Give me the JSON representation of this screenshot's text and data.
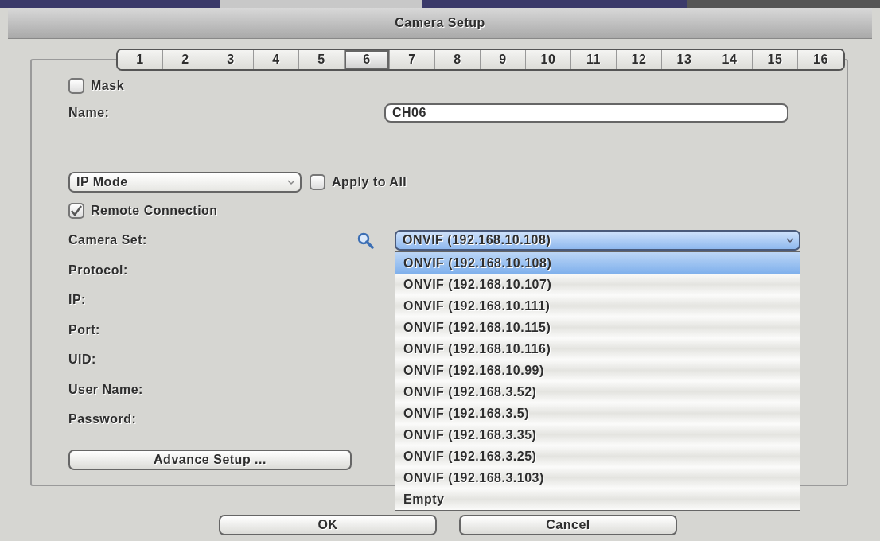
{
  "window": {
    "title": "Camera Setup"
  },
  "channel_tabs": [
    {
      "label": "1",
      "selected": false
    },
    {
      "label": "2",
      "selected": false
    },
    {
      "label": "3",
      "selected": false
    },
    {
      "label": "4",
      "selected": false
    },
    {
      "label": "5",
      "selected": false
    },
    {
      "label": "6",
      "selected": true
    },
    {
      "label": "7",
      "selected": false
    },
    {
      "label": "8",
      "selected": false
    },
    {
      "label": "9",
      "selected": false
    },
    {
      "label": "10",
      "selected": false
    },
    {
      "label": "11",
      "selected": false
    },
    {
      "label": "12",
      "selected": false
    },
    {
      "label": "13",
      "selected": false
    },
    {
      "label": "14",
      "selected": false
    },
    {
      "label": "15",
      "selected": false
    },
    {
      "label": "16",
      "selected": false
    }
  ],
  "mask": {
    "label": "Mask",
    "checked": false
  },
  "name": {
    "label": "Name:",
    "value": "CH06"
  },
  "mode_select": {
    "value": "IP Mode"
  },
  "apply_to_all": {
    "label": "Apply to All",
    "checked": false
  },
  "remote_connection": {
    "label": "Remote Connection",
    "checked": true
  },
  "camera_set": {
    "label": "Camera Set:",
    "value": "ONVIF (192.168.10.108)",
    "expanded": true,
    "options": [
      {
        "label": "ONVIF (192.168.10.108)",
        "selected": true
      },
      {
        "label": "ONVIF (192.168.10.107)",
        "selected": false
      },
      {
        "label": "ONVIF (192.168.10.111)",
        "selected": false
      },
      {
        "label": "ONVIF (192.168.10.115)",
        "selected": false
      },
      {
        "label": "ONVIF (192.168.10.116)",
        "selected": false
      },
      {
        "label": "ONVIF (192.168.10.99)",
        "selected": false
      },
      {
        "label": "ONVIF (192.168.3.52)",
        "selected": false
      },
      {
        "label": "ONVIF (192.168.3.5)",
        "selected": false
      },
      {
        "label": "ONVIF (192.168.3.35)",
        "selected": false
      },
      {
        "label": "ONVIF (192.168.3.25)",
        "selected": false
      },
      {
        "label": "ONVIF (192.168.3.103)",
        "selected": false
      },
      {
        "label": "Empty",
        "selected": false
      }
    ]
  },
  "fields": [
    {
      "label": "Protocol:"
    },
    {
      "label": "IP:"
    },
    {
      "label": "Port:"
    },
    {
      "label": "UID:"
    },
    {
      "label": "User Name:"
    },
    {
      "label": "Password:"
    }
  ],
  "advance_button": "Advance Setup ...",
  "buttons": [
    "OK",
    "Cancel"
  ]
}
